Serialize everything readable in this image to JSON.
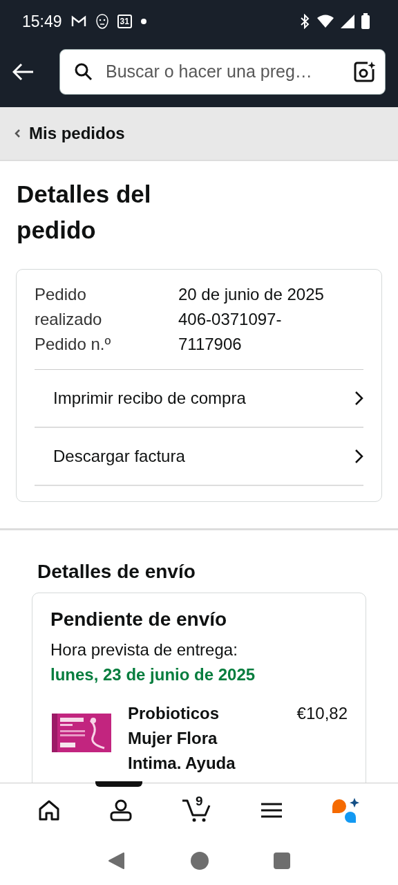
{
  "status_bar": {
    "time": "15:49",
    "calendar_day": "31"
  },
  "search": {
    "placeholder": "Buscar o hacer una preg…"
  },
  "breadcrumb": {
    "label": "Mis pedidos"
  },
  "title": "Detalles del pedido",
  "order_summary": {
    "labels": [
      "Pedido realizado",
      "Pedido n.º"
    ],
    "values": [
      "20 de junio de 2025",
      "406-0371097-7117906"
    ],
    "links": [
      "Imprimir recibo de compra",
      "Descargar factura"
    ]
  },
  "shipping": {
    "heading": "Detalles de envío",
    "status": "Pendiente de envío",
    "eta_label": "Hora prevista de entrega:",
    "eta_date": "lunes, 23 de junio de 2025",
    "items": [
      {
        "title": "Probioticos Mujer Flora Intima. Ayuda",
        "price": "€10,82"
      }
    ]
  },
  "bottom_nav": [
    {
      "kind": "home"
    },
    {
      "kind": "account"
    },
    {
      "kind": "cart",
      "count": "9"
    },
    {
      "kind": "menu"
    },
    {
      "kind": "assistant"
    }
  ]
}
